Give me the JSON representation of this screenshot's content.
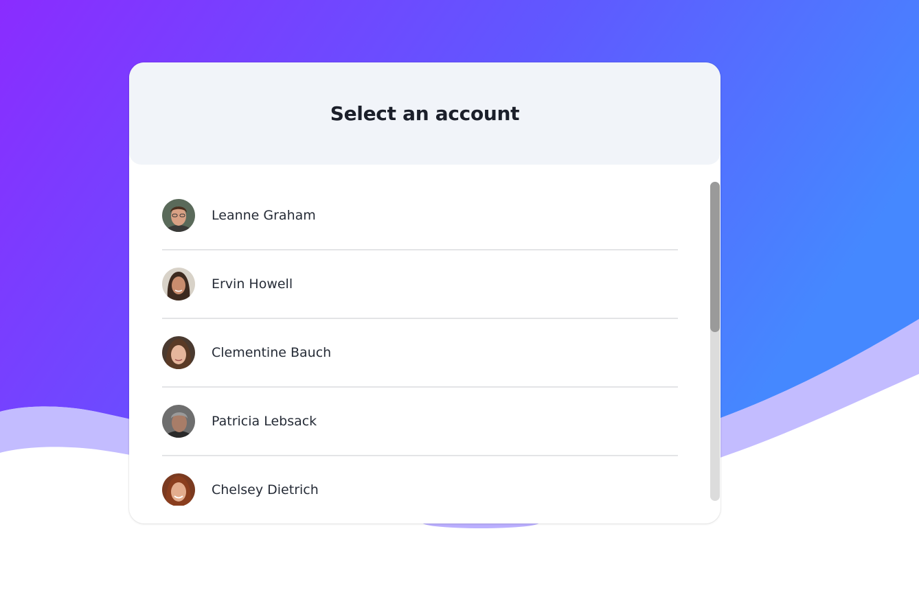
{
  "dialog": {
    "title": "Select an account"
  },
  "accounts": [
    {
      "name": "Leanne Graham",
      "avatar": "avatar-photo"
    },
    {
      "name": "Ervin Howell",
      "avatar": "avatar-photo"
    },
    {
      "name": "Clementine Bauch",
      "avatar": "avatar-photo"
    },
    {
      "name": "Patricia Lebsack",
      "avatar": "avatar-photo"
    },
    {
      "name": "Chelsey Dietrich",
      "avatar": "avatar-photo"
    }
  ],
  "colors": {
    "gradient_start": "#8a2cff",
    "gradient_end": "#4a8bff",
    "header_bg": "#f1f4f9"
  }
}
